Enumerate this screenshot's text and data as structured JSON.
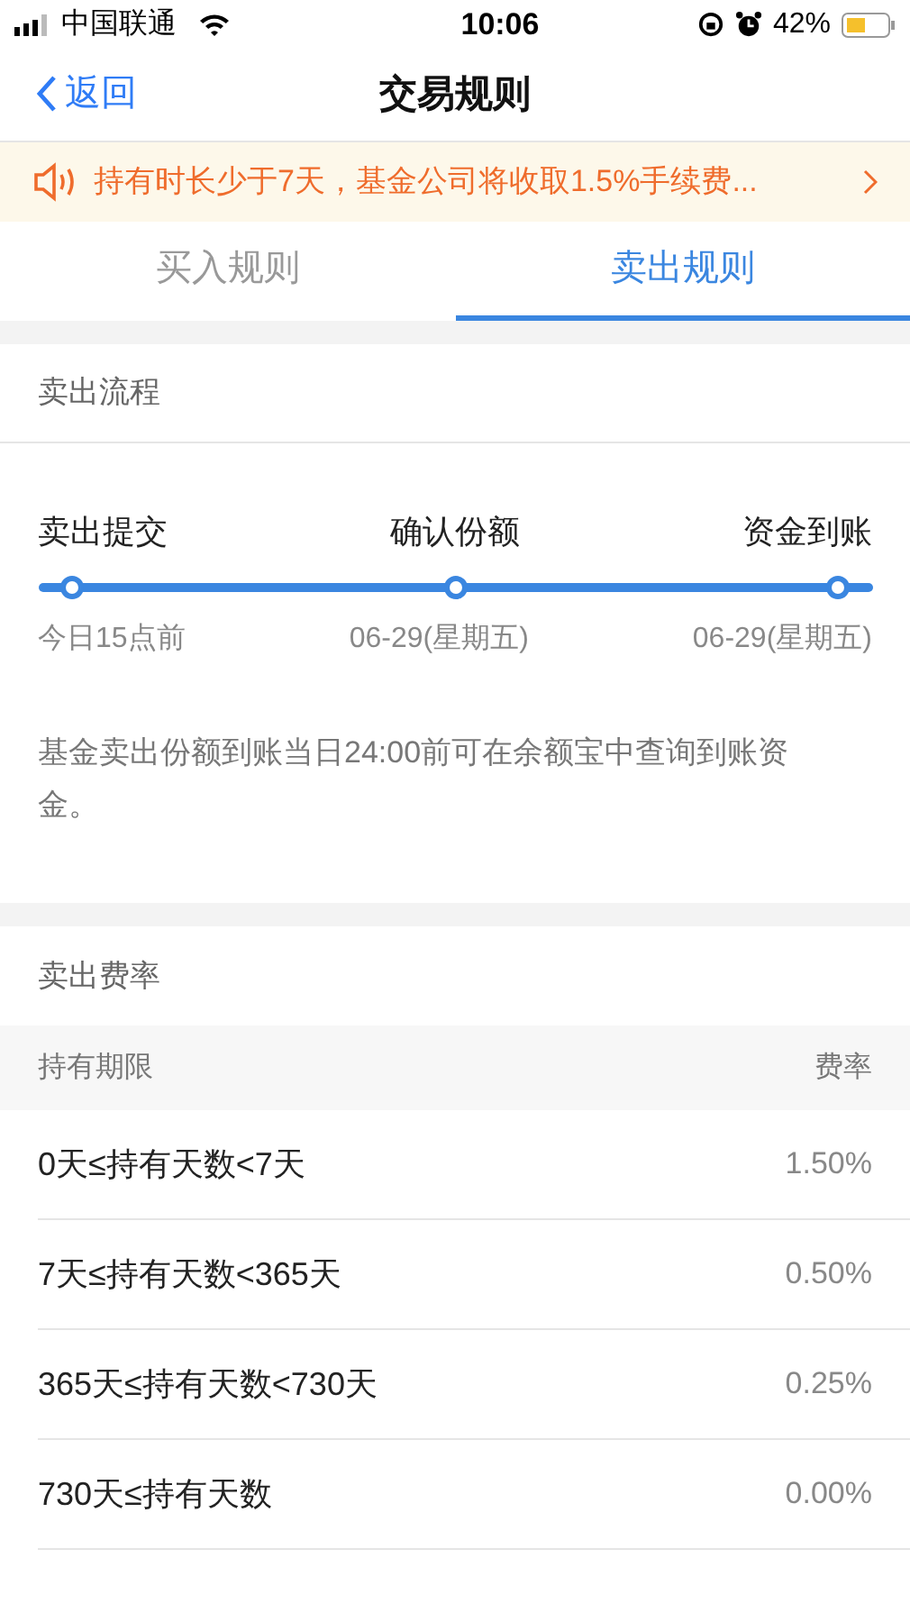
{
  "status_bar": {
    "carrier": "中国联通",
    "time": "10:06",
    "battery": "42%"
  },
  "nav": {
    "back": "返回",
    "title": "交易规则"
  },
  "notice": {
    "text": "持有时长少于7天，基金公司将收取1.5%手续费..."
  },
  "tabs": [
    {
      "label": "买入规则",
      "selected": false
    },
    {
      "label": "卖出规则",
      "selected": true
    }
  ],
  "process": {
    "title": "卖出流程",
    "steps": [
      {
        "label": "卖出提交",
        "time": "今日15点前"
      },
      {
        "label": "确认份额",
        "time": "06-29(星期五)"
      },
      {
        "label": "资金到账",
        "time": "06-29(星期五)"
      }
    ],
    "note": "基金卖出份额到账当日24:00前可在余额宝中查询到账资金。"
  },
  "fees": {
    "title": "卖出费率",
    "columns": [
      "持有期限",
      "费率"
    ],
    "rows": [
      [
        "0天≤持有天数<7天",
        "1.50%"
      ],
      [
        "7天≤持有天数<365天",
        "0.50%"
      ],
      [
        "365天≤持有天数<730天",
        "0.25%"
      ],
      [
        "730天≤持有天数",
        "0.00%"
      ]
    ]
  }
}
